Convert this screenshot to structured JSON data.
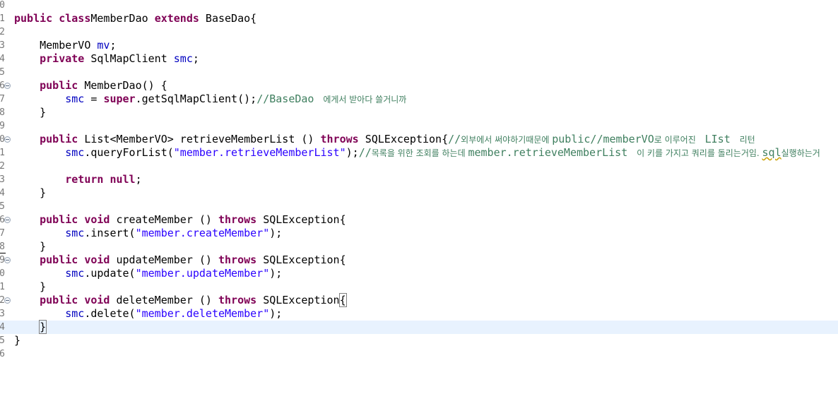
{
  "editor": {
    "lines": [
      {
        "num": "0",
        "fold": false,
        "segments": []
      },
      {
        "num": "1",
        "fold": false,
        "segments": [
          [
            "kw",
            "public class"
          ],
          [
            "",
            "MemberDao "
          ],
          [
            "kw",
            "extends"
          ],
          [
            "",
            " BaseDao{"
          ]
        ]
      },
      {
        "num": "2",
        "fold": false,
        "segments": []
      },
      {
        "num": "3",
        "fold": false,
        "segments": [
          [
            "",
            "    MemberVO "
          ],
          [
            "fld",
            "mv"
          ],
          [
            "",
            ";"
          ]
        ]
      },
      {
        "num": "4",
        "fold": false,
        "segments": [
          [
            "kw",
            "    private"
          ],
          [
            "",
            " SqlMapClient "
          ],
          [
            "fld",
            "smc"
          ],
          [
            "",
            ";"
          ]
        ]
      },
      {
        "num": "5",
        "fold": false,
        "segments": []
      },
      {
        "num": "6",
        "fold": true,
        "segments": [
          [
            "kw",
            "    public"
          ],
          [
            "",
            " MemberDao() {"
          ]
        ]
      },
      {
        "num": "7",
        "fold": false,
        "segments": [
          [
            "fld",
            "        smc"
          ],
          [
            "",
            " = "
          ],
          [
            "kw",
            "super"
          ],
          [
            "",
            ".getSqlMapClient();"
          ],
          [
            "cmt",
            "//BaseDao "
          ],
          [
            "cmt-ko",
            " 에게서 받아다 쓸거니까"
          ]
        ]
      },
      {
        "num": "8",
        "fold": false,
        "segments": [
          [
            "",
            "    }"
          ]
        ]
      },
      {
        "num": "9",
        "fold": false,
        "segments": []
      },
      {
        "num": "0",
        "fold": true,
        "segments": [
          [
            "kw",
            "    public"
          ],
          [
            "",
            " List<MemberVO> retrieveMemberList () "
          ],
          [
            "kw",
            "throws"
          ],
          [
            "",
            " SQLException{"
          ],
          [
            "cmt",
            "//"
          ],
          [
            "cmt-ko",
            "외부에서 써야하기때문에 "
          ],
          [
            "cmt",
            "public//memberVO"
          ],
          [
            "cmt-ko",
            "로 이루어진 "
          ],
          [
            "cmt",
            " LIst "
          ],
          [
            "cmt-ko",
            " 리턴"
          ]
        ]
      },
      {
        "num": "1",
        "fold": false,
        "segments": [
          [
            "fld",
            "        smc"
          ],
          [
            "",
            ".queryForList("
          ],
          [
            "str",
            "\"member.retrieveMemberList\""
          ],
          [
            "",
            ");"
          ],
          [
            "cmt",
            "//"
          ],
          [
            "cmt-ko",
            "목록을 위한 조회를 하는데 "
          ],
          [
            "cmt",
            "member.retrieveMemberList "
          ],
          [
            "cmt-ko",
            " 이 키를 가지고 쿼리를 돌리는거임. "
          ],
          [
            "cmt-sq",
            "sql"
          ],
          [
            "cmt-ko",
            "실행하는거"
          ]
        ]
      },
      {
        "num": "2",
        "fold": false,
        "segments": []
      },
      {
        "num": "3",
        "fold": false,
        "segments": [
          [
            "kw",
            "        return null"
          ],
          [
            "",
            ";"
          ]
        ]
      },
      {
        "num": "4",
        "fold": false,
        "segments": [
          [
            "",
            "    }"
          ]
        ]
      },
      {
        "num": "5",
        "fold": false,
        "segments": []
      },
      {
        "num": "6",
        "fold": true,
        "segments": [
          [
            "kw",
            "    public void"
          ],
          [
            "",
            " createMember () "
          ],
          [
            "kw",
            "throws"
          ],
          [
            "",
            " SQLException{"
          ]
        ]
      },
      {
        "num": "7",
        "fold": false,
        "segments": [
          [
            "fld",
            "        smc"
          ],
          [
            "",
            ".insert("
          ],
          [
            "str",
            "\"member.createMember\""
          ],
          [
            "",
            ");"
          ]
        ]
      },
      {
        "num": "8",
        "fold": false,
        "segments": [
          [
            "",
            "    }"
          ]
        ]
      },
      {
        "num": "9",
        "fold": true,
        "segments": [
          [
            "kw",
            "    public void"
          ],
          [
            "",
            " updateMember () "
          ],
          [
            "kw",
            "throws"
          ],
          [
            "",
            " SQLException{"
          ]
        ]
      },
      {
        "num": "0",
        "fold": false,
        "segments": [
          [
            "fld",
            "        smc"
          ],
          [
            "",
            ".update("
          ],
          [
            "str",
            "\"member.updateMember\""
          ],
          [
            "",
            ");"
          ]
        ]
      },
      {
        "num": "1",
        "fold": false,
        "segments": [
          [
            "",
            "    }"
          ]
        ]
      },
      {
        "num": "2",
        "fold": true,
        "segments": [
          [
            "kw",
            "    public void"
          ],
          [
            "",
            " deleteMember () "
          ],
          [
            "kw",
            "throws"
          ],
          [
            "",
            " SQLException"
          ],
          [
            "box",
            "{"
          ]
        ]
      },
      {
        "num": "3",
        "fold": false,
        "segments": [
          [
            "fld",
            "        smc"
          ],
          [
            "",
            ".delete("
          ],
          [
            "str",
            "\"member.deleteMember\""
          ],
          [
            "",
            ");"
          ]
        ]
      },
      {
        "num": "4",
        "fold": false,
        "current": true,
        "segments": [
          [
            "",
            "    "
          ],
          [
            "box",
            "}"
          ],
          [
            "caret",
            ""
          ]
        ]
      },
      {
        "num": "5",
        "fold": false,
        "segments": [
          [
            "",
            "}"
          ]
        ]
      },
      {
        "num": "6",
        "fold": false,
        "segments": []
      }
    ]
  },
  "colors": {
    "keyword": "#7f0055",
    "field": "#0000c0",
    "string": "#2a00ff",
    "comment": "#3f7f5f",
    "current_line": "#e8f2fe"
  }
}
